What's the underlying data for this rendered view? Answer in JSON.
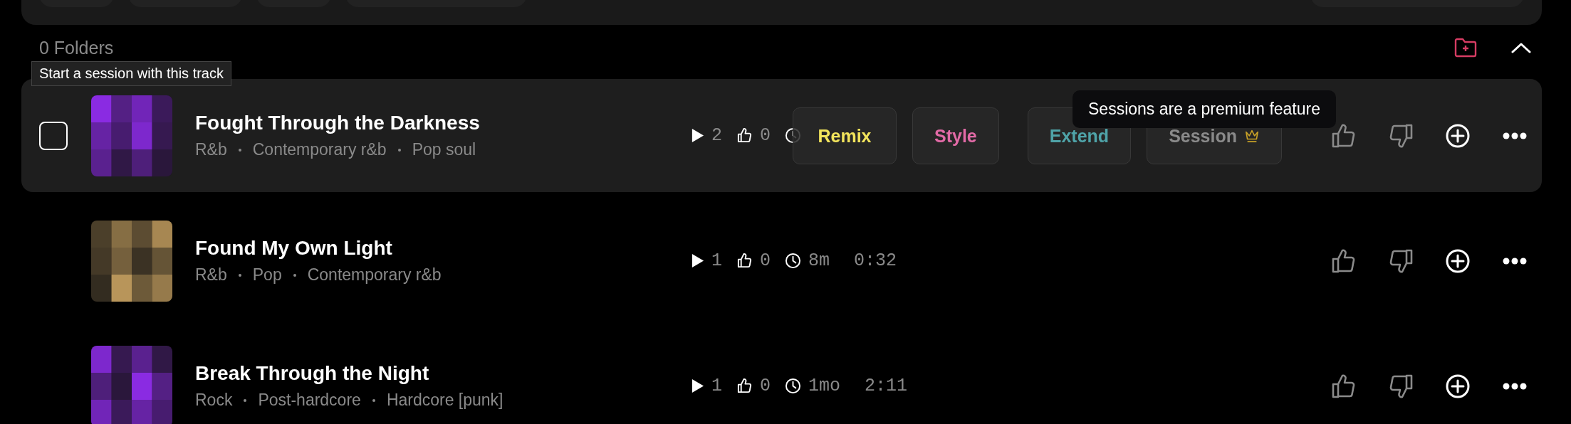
{
  "folders": {
    "label": "0 Folders"
  },
  "tooltips": [
    {
      "kind": "plain",
      "text": "Start a session with this track"
    },
    {
      "kind": "dark",
      "text": "Sessions are a premium feature"
    }
  ],
  "tracks": [
    {
      "title": "Fought Through the Darkness",
      "genres": [
        "R&b",
        "Contemporary r&b",
        "Pop soul"
      ],
      "plays": "2",
      "likes": "0",
      "hovered": true,
      "checked": false,
      "actions": [
        {
          "label": "Remix",
          "color": "#f2e45c",
          "premium": false
        },
        {
          "label": "Style",
          "color": "#e26aa6",
          "premium": false
        },
        {
          "label": "Extend",
          "color": "#4fa3a8",
          "premium": false
        },
        {
          "label": "Session",
          "color": "#8a8a8a",
          "premium": true
        }
      ]
    },
    {
      "title": "Found My Own Light",
      "genres": [
        "R&b",
        "Pop",
        "Contemporary r&b"
      ],
      "plays": "1",
      "likes": "0",
      "age": "8m",
      "duration": "0:32",
      "hovered": false
    },
    {
      "title": "Break Through the Night",
      "genres": [
        "Rock",
        "Post-hardcore",
        "Hardcore [punk]"
      ],
      "plays": "1",
      "likes": "0",
      "age": "1mo",
      "duration": "2:11",
      "hovered": false
    }
  ]
}
